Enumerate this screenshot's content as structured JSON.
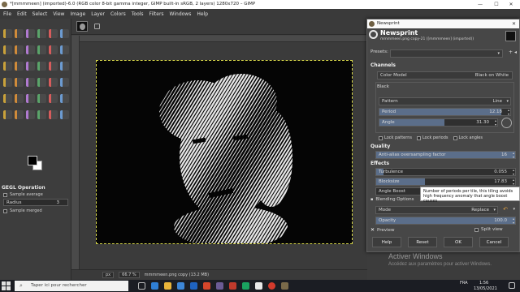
{
  "window": {
    "title": "*[mmmmeen] (imported)-6.0 (RGB color 8-bit gamma integer, GIMP built-in sRGB, 2 layers) 1280x720 – GIMP",
    "controls": [
      "—",
      "☐",
      "✕"
    ]
  },
  "menu": [
    "File",
    "Edit",
    "Select",
    "View",
    "Image",
    "Layer",
    "Colors",
    "Tools",
    "Filters",
    "Windows",
    "Help"
  ],
  "tool_options": {
    "heading": "GEGL Operation",
    "sample_average": "Sample average",
    "radius_label": "Radius",
    "radius_value": "3",
    "sample_merged": "Sample merged"
  },
  "statusbar": {
    "unit": "px",
    "zoom": "66.7 %",
    "layer_info": "mmmmeen.png copy (13.2 MB)"
  },
  "dialog": {
    "window_title": "Newsprint",
    "heading": "Newsprint",
    "subheading": "mmmmeen.png copy-21 ([mmmmeen] (imported))",
    "presets_label": "Presets:",
    "channels_heading": "Channels",
    "color_model_label": "Color Model",
    "color_model_value": "Black on White",
    "black_tab": "Black",
    "pattern_label": "Pattern",
    "pattern_value": "Line",
    "period_label": "Period",
    "period_value": "12.18",
    "period_fraction": 0.93,
    "angle_label": "Angle",
    "angle_value": "31.30",
    "angle_fraction": 0.55,
    "lock_patterns": "Lock patterns",
    "lock_periods": "Lock periods",
    "lock_angles": "Lock angles",
    "quality_heading": "Quality",
    "aa_label": "Anti-alias oversampling factor",
    "aa_value": "16",
    "aa_fraction": 1.0,
    "effects_heading": "Effects",
    "turbulence_label": "Turbulence",
    "turbulence_value": "0.055",
    "turbulence_fraction": 0.05,
    "blocksize_label": "Blocksize",
    "blocksize_value": "17.83",
    "blocksize_fraction": 0.35,
    "angle_boost_label": "Angle Boost",
    "blending_label": "Blending Options",
    "mode_label": "Mode",
    "mode_value": "Replace",
    "opacity_label": "Opacity",
    "opacity_value": "100.0",
    "opacity_fraction": 1.0,
    "preview_label": "Preview",
    "split_view_label": "Split view",
    "tooltip": "Number of periods per tile, this tiling avoids high frequency anomaly that angle boost causes",
    "buttons": {
      "help": "Help",
      "reset": "Reset",
      "ok": "OK",
      "cancel": "Cancel"
    }
  },
  "watermark": {
    "line1": "Activer Windows",
    "line2": "Accédez aux paramètres pour activer Windows."
  },
  "taskbar": {
    "search_placeholder": "Taper ici pour rechercher",
    "language": "FRA",
    "time": "1:56",
    "date": "13/05/2021"
  },
  "colors": {
    "accent": "#5b6e8a",
    "fg_color": "#000000",
    "bg_color": "#ffffff",
    "selection_outline": "#d8d84a"
  }
}
